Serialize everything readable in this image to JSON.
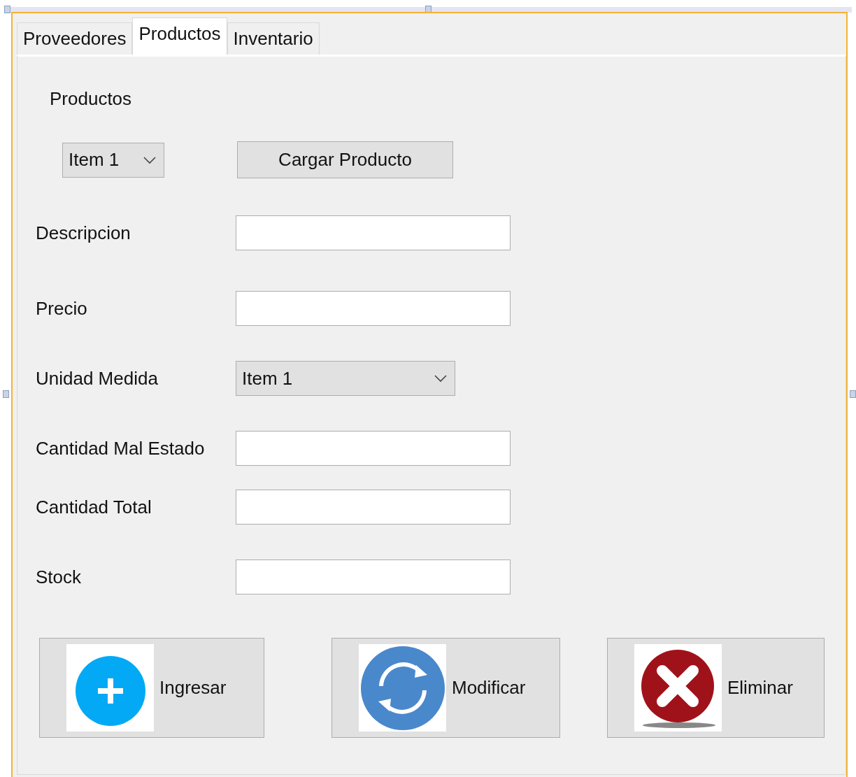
{
  "tabs": [
    {
      "label": "Proveedores",
      "selected": false
    },
    {
      "label": "Productos",
      "selected": true
    },
    {
      "label": "Inventario",
      "selected": false
    }
  ],
  "panel": {
    "title": "Productos",
    "selector": {
      "value": "Item 1"
    },
    "load_button": "Cargar Producto",
    "fields": [
      {
        "kind": "text",
        "label": "Descripcion"
      },
      {
        "kind": "text",
        "label": "Precio"
      },
      {
        "kind": "combo",
        "label": "Unidad Medida",
        "value": "Item 1"
      },
      {
        "kind": "text",
        "label": "Cantidad Mal Estado"
      },
      {
        "kind": "text",
        "label": "Cantidad Total"
      },
      {
        "kind": "text",
        "label": "Stock"
      }
    ],
    "actions": [
      {
        "kind": "add",
        "label": "Ingresar"
      },
      {
        "kind": "refresh",
        "label": "Modificar"
      },
      {
        "kind": "delete",
        "label": "Eliminar"
      }
    ]
  }
}
